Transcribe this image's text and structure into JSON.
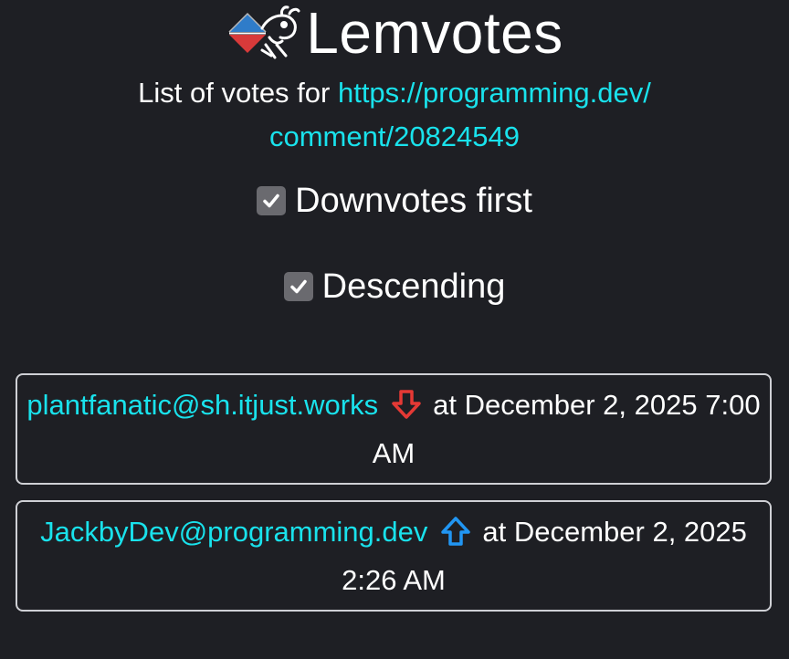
{
  "app": {
    "title": "Lemvotes"
  },
  "header": {
    "subtitle_prefix": "List of votes for ",
    "url_part1": "https://programming.dev/",
    "url_part2": "comment/20824549"
  },
  "options": [
    {
      "label": "Downvotes first",
      "checked": true
    },
    {
      "label": "Descending",
      "checked": true
    }
  ],
  "votes": [
    {
      "user": "plantfanatic@sh.itjust.works",
      "type": "downvote",
      "icon": "down-arrow-icon",
      "date_text": "at December 2, 2025 7:00 AM"
    },
    {
      "user": "JackbyDev@programming.dev",
      "type": "upvote",
      "icon": "up-arrow-icon",
      "date_text": "at December 2, 2025 2:26 AM"
    }
  ],
  "colors": {
    "background": "#1e1f24",
    "link": "#19e2ec",
    "downvote": "#e53935",
    "upvote": "#2196f3",
    "card_border": "#cfd0d5",
    "checkbox": "#6a6a6f"
  }
}
